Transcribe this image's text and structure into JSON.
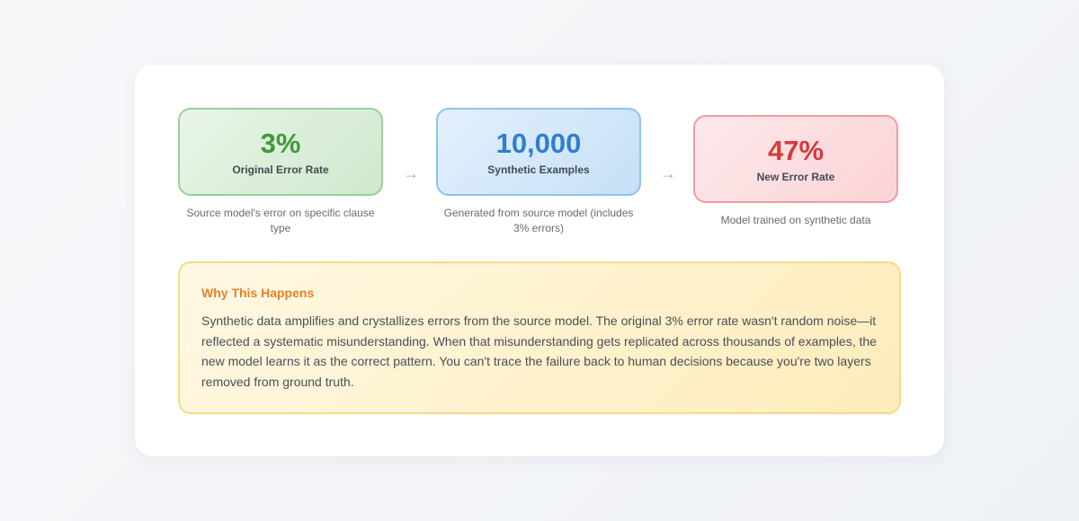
{
  "flow": {
    "stages": [
      {
        "value": "3%",
        "label": "Original Error Rate",
        "description": "Source model's error on specific clause type",
        "color": "#3d9a3f"
      },
      {
        "value": "10,000",
        "label": "Synthetic Examples",
        "description": "Generated from source model (includes 3% errors)",
        "color": "#2f7fcf"
      },
      {
        "value": "47%",
        "label": "New Error Rate",
        "description": "Model trained on synthetic data",
        "color": "#d8393b"
      }
    ],
    "arrow_symbol": "→"
  },
  "explanation": {
    "title": "Why This Happens",
    "body": "Synthetic data amplifies and crystallizes errors from the source model. The original 3% error rate wasn't random noise—it reflected a systematic misunderstanding. When that misunderstanding gets replicated across thousands of examples, the new model learns it as the correct pattern. You can't trace the failure back to human decisions because you're two layers removed from ground truth.",
    "accent_color": "#e4822a"
  }
}
